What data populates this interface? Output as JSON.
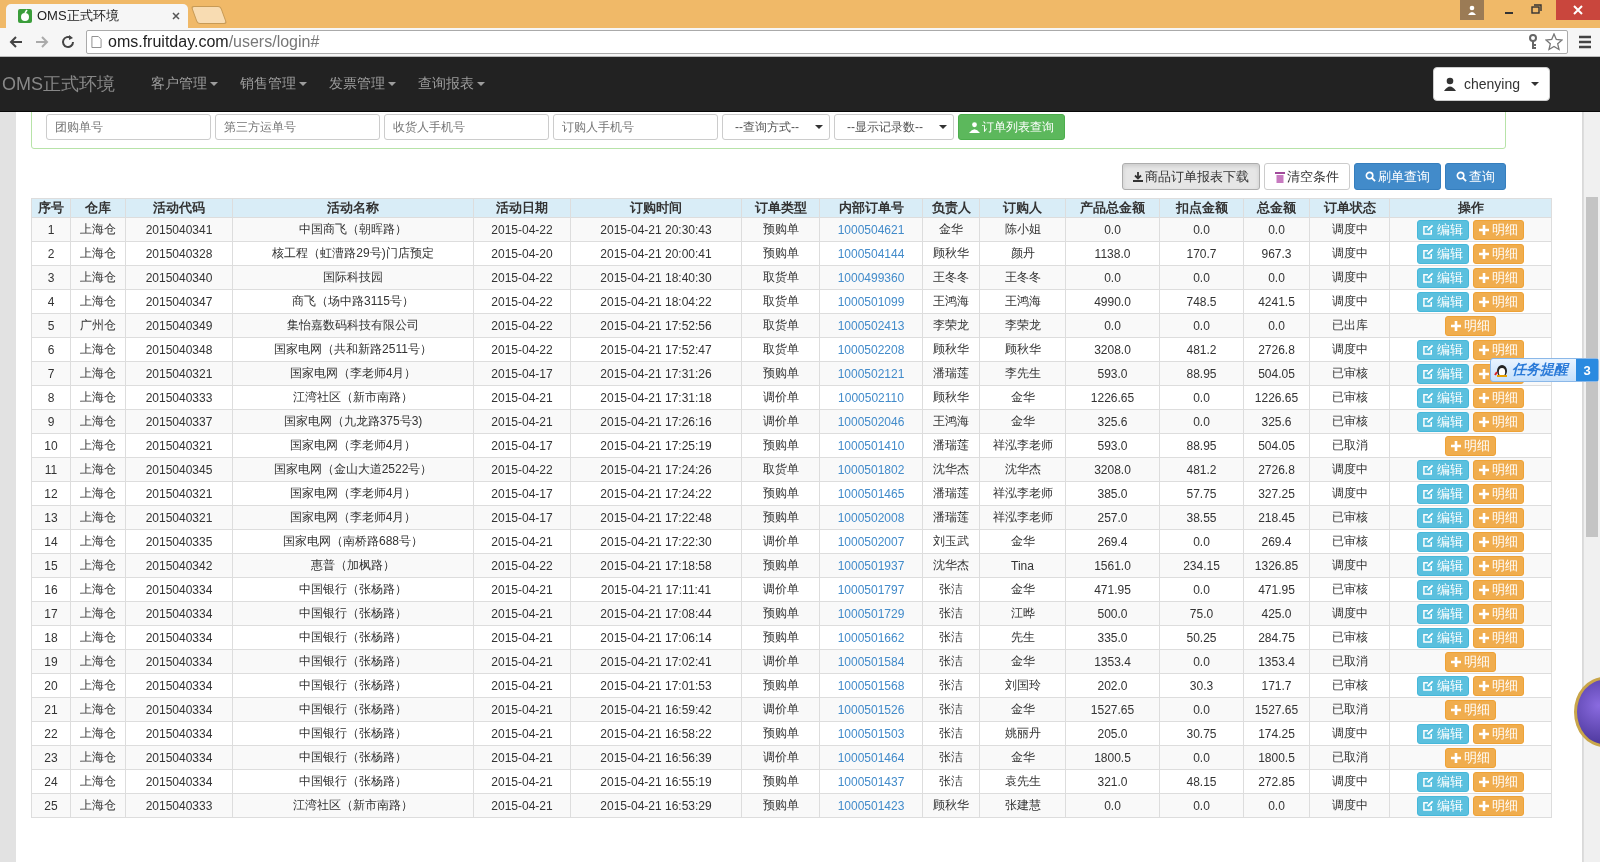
{
  "browser": {
    "tab_title": "OMS正式环境",
    "url_host": "oms.fruitday.com",
    "url_path": "/users/login#"
  },
  "navbar": {
    "brand": "OMS正式环境",
    "menus": [
      "客户管理",
      "销售管理",
      "发票管理",
      "查询报表"
    ],
    "user": "chenying"
  },
  "search_panel": {
    "fields": [
      {
        "placeholder": "团购单号"
      },
      {
        "placeholder": "第三方运单号"
      },
      {
        "placeholder": "收货人手机号"
      },
      {
        "placeholder": "订购人手机号"
      }
    ],
    "selects": [
      "--查询方式--",
      "--显示记录数--"
    ],
    "list_button": "订单列表查询"
  },
  "toolbar": [
    {
      "kind": "download",
      "label": "商品订单报表下载"
    },
    {
      "kind": "clear",
      "label": "清空条件"
    },
    {
      "kind": "search",
      "label": "刷单查询"
    },
    {
      "kind": "search",
      "label": "查询"
    }
  ],
  "table": {
    "columns": [
      {
        "label": "序号",
        "kind": "text"
      },
      {
        "label": "仓库",
        "kind": "text"
      },
      {
        "label": "活动代码",
        "kind": "text"
      },
      {
        "label": "活动名称",
        "kind": "text"
      },
      {
        "label": "活动日期",
        "kind": "text"
      },
      {
        "label": "订购时间",
        "kind": "text"
      },
      {
        "label": "订单类型",
        "kind": "text"
      },
      {
        "label": "内部订单号",
        "kind": "link"
      },
      {
        "label": "负责人",
        "kind": "text"
      },
      {
        "label": "订购人",
        "kind": "text"
      },
      {
        "label": "产品总金额",
        "kind": "text"
      },
      {
        "label": "扣点金额",
        "kind": "text"
      },
      {
        "label": "总金额",
        "kind": "text"
      },
      {
        "label": "订单状态",
        "kind": "text"
      },
      {
        "label": "操作",
        "kind": "actions"
      }
    ],
    "rows": [
      {
        "cells": [
          "1",
          "上海仓",
          "2015040341",
          "中国商飞（朝晖路）",
          "2015-04-22",
          "2015-04-21 20:30:43",
          "预购单",
          "1000504621",
          "金华",
          "陈小姐",
          "0.0",
          "0.0",
          "0.0",
          "调度中"
        ],
        "actions": [
          {
            "kind": "edit",
            "label": "编辑"
          },
          {
            "kind": "detail",
            "label": "明细"
          }
        ]
      },
      {
        "cells": [
          "2",
          "上海仓",
          "2015040328",
          "核工程（虹漕路29号)门店预定",
          "2015-04-20",
          "2015-04-21 20:00:41",
          "预购单",
          "1000504144",
          "顾秋华",
          "颜丹",
          "1138.0",
          "170.7",
          "967.3",
          "调度中"
        ],
        "actions": [
          {
            "kind": "edit",
            "label": "编辑"
          },
          {
            "kind": "detail",
            "label": "明细"
          }
        ]
      },
      {
        "cells": [
          "3",
          "上海仓",
          "2015040340",
          "国际科技园",
          "2015-04-22",
          "2015-04-21 18:40:30",
          "取货单",
          "1000499360",
          "王冬冬",
          "王冬冬",
          "0.0",
          "0.0",
          "0.0",
          "调度中"
        ],
        "actions": [
          {
            "kind": "edit",
            "label": "编辑"
          },
          {
            "kind": "detail",
            "label": "明细"
          }
        ]
      },
      {
        "cells": [
          "4",
          "上海仓",
          "2015040347",
          "商飞（场中路3115号）",
          "2015-04-22",
          "2015-04-21 18:04:22",
          "取货单",
          "1000501099",
          "王鸿海",
          "王鸿海",
          "4990.0",
          "748.5",
          "4241.5",
          "调度中"
        ],
        "actions": [
          {
            "kind": "edit",
            "label": "编辑"
          },
          {
            "kind": "detail",
            "label": "明细"
          }
        ]
      },
      {
        "cells": [
          "5",
          "广州仓",
          "2015040349",
          "集怡嘉数码科技有限公司",
          "2015-04-22",
          "2015-04-21 17:52:56",
          "取货单",
          "1000502413",
          "李荣龙",
          "李荣龙",
          "0.0",
          "0.0",
          "0.0",
          "已出库"
        ],
        "actions": [
          {
            "kind": "detail",
            "label": "明细"
          }
        ]
      },
      {
        "cells": [
          "6",
          "上海仓",
          "2015040348",
          "国家电网（共和新路2511号）",
          "2015-04-22",
          "2015-04-21 17:52:47",
          "取货单",
          "1000502208",
          "顾秋华",
          "顾秋华",
          "3208.0",
          "481.2",
          "2726.8",
          "调度中"
        ],
        "actions": [
          {
            "kind": "edit",
            "label": "编辑"
          },
          {
            "kind": "detail",
            "label": "明细"
          }
        ]
      },
      {
        "cells": [
          "7",
          "上海仓",
          "2015040321",
          "国家电网（李老师4月）",
          "2015-04-17",
          "2015-04-21 17:31:26",
          "预购单",
          "1000502121",
          "潘瑞莲",
          "李先生",
          "593.0",
          "88.95",
          "504.05",
          "已审核"
        ],
        "actions": [
          {
            "kind": "edit",
            "label": "编辑"
          },
          {
            "kind": "detail"
          }
        ]
      },
      {
        "cells": [
          "8",
          "上海仓",
          "2015040333",
          "江湾社区（新市南路）",
          "2015-04-21",
          "2015-04-21 17:31:18",
          "调价单",
          "1000502110",
          "顾秋华",
          "金华",
          "1226.65",
          "0.0",
          "1226.65",
          "已审核"
        ],
        "actions": [
          {
            "kind": "edit",
            "label": "编辑"
          },
          {
            "kind": "detail",
            "label": "明细"
          }
        ]
      },
      {
        "cells": [
          "9",
          "上海仓",
          "2015040337",
          "国家电网（九龙路375号3)",
          "2015-04-21",
          "2015-04-21 17:26:16",
          "调价单",
          "1000502046",
          "王鸿海",
          "金华",
          "325.6",
          "0.0",
          "325.6",
          "已审核"
        ],
        "actions": [
          {
            "kind": "edit",
            "label": "编辑"
          },
          {
            "kind": "detail",
            "label": "明细"
          }
        ]
      },
      {
        "cells": [
          "10",
          "上海仓",
          "2015040321",
          "国家电网（李老师4月）",
          "2015-04-17",
          "2015-04-21 17:25:19",
          "预购单",
          "1000501410",
          "潘瑞莲",
          "祥泓李老师",
          "593.0",
          "88.95",
          "504.05",
          "已取消"
        ],
        "actions": [
          {
            "kind": "detail",
            "label": "明细"
          }
        ]
      },
      {
        "cells": [
          "11",
          "上海仓",
          "2015040345",
          "国家电网（金山大道2522号）",
          "2015-04-22",
          "2015-04-21 17:24:26",
          "取货单",
          "1000501802",
          "沈华杰",
          "沈华杰",
          "3208.0",
          "481.2",
          "2726.8",
          "调度中"
        ],
        "actions": [
          {
            "kind": "edit",
            "label": "编辑"
          },
          {
            "kind": "detail",
            "label": "明细"
          }
        ]
      },
      {
        "cells": [
          "12",
          "上海仓",
          "2015040321",
          "国家电网（李老师4月）",
          "2015-04-17",
          "2015-04-21 17:24:22",
          "预购单",
          "1000501465",
          "潘瑞莲",
          "祥泓李老师",
          "385.0",
          "57.75",
          "327.25",
          "调度中"
        ],
        "actions": [
          {
            "kind": "edit",
            "label": "编辑"
          },
          {
            "kind": "detail",
            "label": "明细"
          }
        ]
      },
      {
        "cells": [
          "13",
          "上海仓",
          "2015040321",
          "国家电网（李老师4月）",
          "2015-04-17",
          "2015-04-21 17:22:48",
          "预购单",
          "1000502008",
          "潘瑞莲",
          "祥泓李老师",
          "257.0",
          "38.55",
          "218.45",
          "已审核"
        ],
        "actions": [
          {
            "kind": "edit",
            "label": "编辑"
          },
          {
            "kind": "detail",
            "label": "明细"
          }
        ]
      },
      {
        "cells": [
          "14",
          "上海仓",
          "2015040335",
          "国家电网（南桥路688号）",
          "2015-04-21",
          "2015-04-21 17:22:30",
          "调价单",
          "1000502007",
          "刘玉武",
          "金华",
          "269.4",
          "0.0",
          "269.4",
          "已审核"
        ],
        "actions": [
          {
            "kind": "edit",
            "label": "编辑"
          },
          {
            "kind": "detail",
            "label": "明细"
          }
        ]
      },
      {
        "cells": [
          "15",
          "上海仓",
          "2015040342",
          "惠普（加枫路）",
          "2015-04-22",
          "2015-04-21 17:18:58",
          "预购单",
          "1000501937",
          "沈华杰",
          "Tina",
          "1561.0",
          "234.15",
          "1326.85",
          "调度中"
        ],
        "actions": [
          {
            "kind": "edit",
            "label": "编辑"
          },
          {
            "kind": "detail",
            "label": "明细"
          }
        ]
      },
      {
        "cells": [
          "16",
          "上海仓",
          "2015040334",
          "中国银行（张杨路）",
          "2015-04-21",
          "2015-04-21 17:11:41",
          "调价单",
          "1000501797",
          "张洁",
          "金华",
          "471.95",
          "0.0",
          "471.95",
          "已审核"
        ],
        "actions": [
          {
            "kind": "edit",
            "label": "编辑"
          },
          {
            "kind": "detail",
            "label": "明细"
          }
        ]
      },
      {
        "cells": [
          "17",
          "上海仓",
          "2015040334",
          "中国银行（张杨路）",
          "2015-04-21",
          "2015-04-21 17:08:44",
          "预购单",
          "1000501729",
          "张洁",
          "江晔",
          "500.0",
          "75.0",
          "425.0",
          "调度中"
        ],
        "actions": [
          {
            "kind": "edit",
            "label": "编辑"
          },
          {
            "kind": "detail",
            "label": "明细"
          }
        ]
      },
      {
        "cells": [
          "18",
          "上海仓",
          "2015040334",
          "中国银行（张杨路）",
          "2015-04-21",
          "2015-04-21 17:06:14",
          "预购单",
          "1000501662",
          "张洁",
          "先生",
          "335.0",
          "50.25",
          "284.75",
          "已审核"
        ],
        "actions": [
          {
            "kind": "edit",
            "label": "编辑"
          },
          {
            "kind": "detail",
            "label": "明细"
          }
        ]
      },
      {
        "cells": [
          "19",
          "上海仓",
          "2015040334",
          "中国银行（张杨路）",
          "2015-04-21",
          "2015-04-21 17:02:41",
          "调价单",
          "1000501584",
          "张洁",
          "金华",
          "1353.4",
          "0.0",
          "1353.4",
          "已取消"
        ],
        "actions": [
          {
            "kind": "detail",
            "label": "明细"
          }
        ]
      },
      {
        "cells": [
          "20",
          "上海仓",
          "2015040334",
          "中国银行（张杨路）",
          "2015-04-21",
          "2015-04-21 17:01:53",
          "预购单",
          "1000501568",
          "张洁",
          "刘国玲",
          "202.0",
          "30.3",
          "171.7",
          "已审核"
        ],
        "actions": [
          {
            "kind": "edit",
            "label": "编辑"
          },
          {
            "kind": "detail",
            "label": "明细"
          }
        ]
      },
      {
        "cells": [
          "21",
          "上海仓",
          "2015040334",
          "中国银行（张杨路）",
          "2015-04-21",
          "2015-04-21 16:59:42",
          "调价单",
          "1000501526",
          "张洁",
          "金华",
          "1527.65",
          "0.0",
          "1527.65",
          "已取消"
        ],
        "actions": [
          {
            "kind": "detail",
            "label": "明细"
          }
        ]
      },
      {
        "cells": [
          "22",
          "上海仓",
          "2015040334",
          "中国银行（张杨路）",
          "2015-04-21",
          "2015-04-21 16:58:22",
          "预购单",
          "1000501503",
          "张洁",
          "姚丽丹",
          "205.0",
          "30.75",
          "174.25",
          "调度中"
        ],
        "actions": [
          {
            "kind": "edit",
            "label": "编辑"
          },
          {
            "kind": "detail",
            "label": "明细"
          }
        ]
      },
      {
        "cells": [
          "23",
          "上海仓",
          "2015040334",
          "中国银行（张杨路）",
          "2015-04-21",
          "2015-04-21 16:56:39",
          "调价单",
          "1000501464",
          "张洁",
          "金华",
          "1800.5",
          "0.0",
          "1800.5",
          "已取消"
        ],
        "actions": [
          {
            "kind": "detail",
            "label": "明细"
          }
        ]
      },
      {
        "cells": [
          "24",
          "上海仓",
          "2015040334",
          "中国银行（张杨路）",
          "2015-04-21",
          "2015-04-21 16:55:19",
          "预购单",
          "1000501437",
          "张洁",
          "袁先生",
          "321.0",
          "48.15",
          "272.85",
          "调度中"
        ],
        "actions": [
          {
            "kind": "edit",
            "label": "编辑"
          },
          {
            "kind": "detail",
            "label": "明细"
          }
        ]
      },
      {
        "cells": [
          "25",
          "上海仓",
          "2015040333",
          "江湾社区（新市南路）",
          "2015-04-21",
          "2015-04-21 16:53:29",
          "预购单",
          "1000501423",
          "顾秋华",
          "张建慧",
          "0.0",
          "0.0",
          "0.0",
          "调度中"
        ],
        "actions": [
          {
            "kind": "edit",
            "label": "编辑"
          },
          {
            "kind": "detail",
            "label": "明细"
          }
        ]
      }
    ]
  },
  "task_reminder": {
    "label": "任务提醒",
    "count": "3"
  }
}
